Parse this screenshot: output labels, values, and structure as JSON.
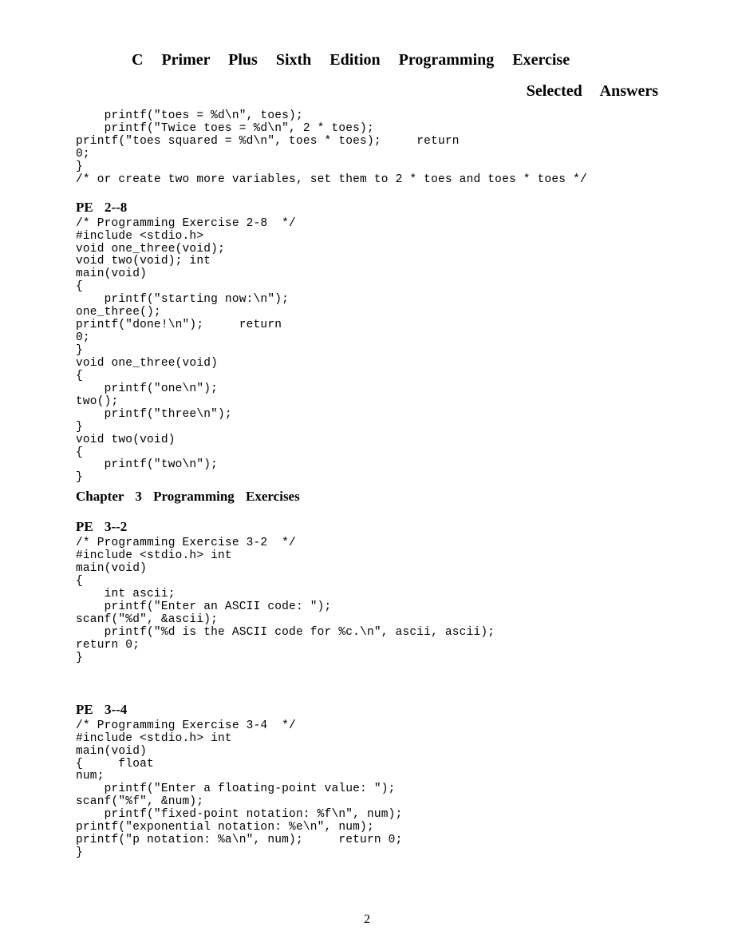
{
  "title_line1": "C Primer Plus Sixth Edition Programming Exercise",
  "title_line2": "Selected Answers",
  "code_intro": "    printf(\"toes = %d\\n\", toes);\n    printf(\"Twice toes = %d\\n\", 2 * toes);\nprintf(\"toes squared = %d\\n\", toes * toes);     return\n0;\n}\n/* or create two more variables, set them to 2 * toes and toes * toes */",
  "pe_2_8_heading": "PE 2-‐8",
  "code_2_8": "/* Programming Exercise 2-8  */\n#include <stdio.h>\nvoid one_three(void);\nvoid two(void); int\nmain(void)\n{\n    printf(\"starting now:\\n\");\none_three();\nprintf(\"done!\\n\");     return\n0;\n}\nvoid one_three(void)\n{\n    printf(\"one\\n\");\ntwo();\n    printf(\"three\\n\");\n}\nvoid two(void)\n{\n    printf(\"two\\n\");\n}",
  "chapter3_heading": "Chapter 3 Programming Exercises",
  "pe_3_2_heading": "PE 3-‐2",
  "code_3_2": "/* Programming Exercise 3-2  */\n#include <stdio.h> int\nmain(void)\n{\n    int ascii;\n    printf(\"Enter an ASCII code: \");\nscanf(\"%d\", &ascii);\n    printf(\"%d is the ASCII code for %c.\\n\", ascii, ascii);\nreturn 0;\n}",
  "pe_3_4_heading": "PE 3-‐4",
  "code_3_4": "/* Programming Exercise 3-4  */\n#include <stdio.h> int\nmain(void)\n{     float\nnum;\n    printf(\"Enter a floating-point value: \");\nscanf(\"%f\", &num);\n    printf(\"fixed-point notation: %f\\n\", num);\nprintf(\"exponential notation: %e\\n\", num);\nprintf(\"p notation: %a\\n\", num);     return 0;\n}",
  "page_number": "2"
}
